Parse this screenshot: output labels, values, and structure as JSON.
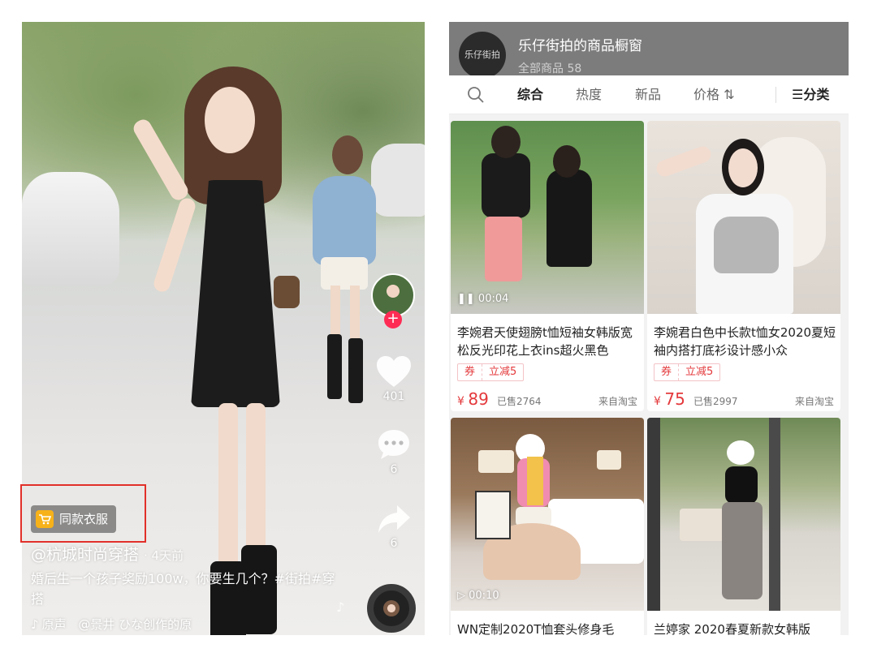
{
  "video": {
    "likes": "401",
    "comments": "6",
    "shares": "6",
    "shop_tag": "同款衣服",
    "author": "@杭城时尚穿搭",
    "time": "· 4天前",
    "caption": "婚后生一个孩子奖励100w，你要生几个？#街拍#穿搭",
    "music_prefix": "原声",
    "music_text": "@景井 ひな创作的原"
  },
  "shop": {
    "store_name": "乐仔街拍的商品橱窗",
    "store_logo_text": "乐仔街拍",
    "total_label": "全部商品 58",
    "sort": [
      "综合",
      "热度",
      "新品",
      "价格 ⇅"
    ],
    "category": "分类",
    "products": [
      {
        "badge": "00:04",
        "title": "李婉君天使翅膀t恤短袖女韩版宽松反光印花上衣ins超火黑色",
        "coupon_label": "券",
        "coupon_value": "立减5",
        "price_symbol": "¥",
        "price": "89",
        "sold": "已售2764",
        "source": "来自淘宝"
      },
      {
        "badge": "",
        "title": "李婉君白色中长款t恤女2020夏短袖内搭打底衫设计感小众",
        "coupon_label": "券",
        "coupon_value": "立减5",
        "price_symbol": "¥",
        "price": "75",
        "sold": "已售2997",
        "source": "来自淘宝"
      },
      {
        "badge": "00:10",
        "title": "WN定制2020T恤套头修身毛"
      },
      {
        "badge": "",
        "title": "兰婷家 2020春夏新款女韩版"
      }
    ]
  },
  "colors": {
    "accent_red": "#e4393c",
    "follow_red": "#fe2c55",
    "cart_yellow": "#f7b21a",
    "highlight_box": "#e2302a"
  }
}
